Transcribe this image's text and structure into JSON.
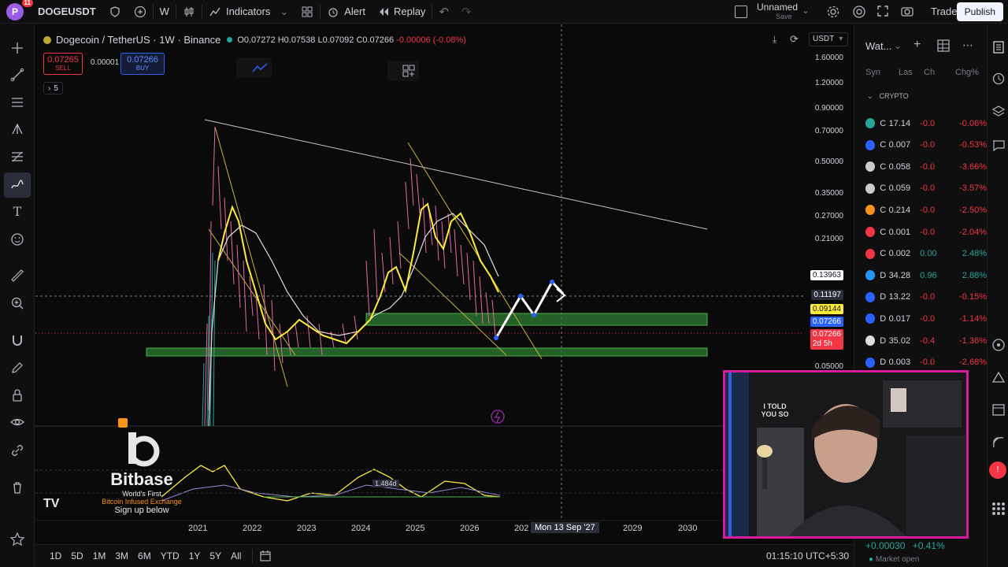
{
  "topbar": {
    "badge_count": "11",
    "symbol": "DOGEUSDT",
    "interval": "W",
    "indicators_label": "Indicators",
    "alert_label": "Alert",
    "replay_label": "Replay",
    "layout_name": "Unnamed",
    "layout_status": "Save",
    "trade_label": "Trade",
    "publish_label": "Publish"
  },
  "legend": {
    "title": "Dogecoin / TetherUS · 1W · Binance",
    "open": "O0.07272",
    "high": "H0.07538",
    "low": "L0.07092",
    "close": "C0.07266",
    "change": "-0.00006 (-0.08%)"
  },
  "trade": {
    "sell_price": "0.07265",
    "sell_label": "SELL",
    "spread": "0.00001",
    "buy_price": "0.07266",
    "buy_label": "BUY"
  },
  "indicator_count": "5",
  "currency": "USDT",
  "price_axis": [
    "1.60000",
    "1.20000",
    "0.90000",
    "0.70000",
    "0.50000",
    "0.35000",
    "0.27000",
    "0.21000",
    "0.05000"
  ],
  "price_tags": {
    "hover": "0.13963",
    "crosshair": "0.11197",
    "yellow": "0.09144",
    "blue": "0.07266",
    "last": "0.07266",
    "countdown": "2d 5h"
  },
  "time_axis": [
    "2021",
    "2022",
    "2023",
    "2024",
    "2025",
    "2026",
    "202",
    "2029",
    "2030"
  ],
  "time_crosshair": "Mon 13 Sep '27",
  "volume_label": "1.484d",
  "bitbase": {
    "name": "Bitbase",
    "tagline1": "World's First",
    "tagline2": "Bitcoin Infused Exchange",
    "cta": "Sign up below"
  },
  "timeframes": [
    "1D",
    "5D",
    "1M",
    "3M",
    "6M",
    "YTD",
    "1Y",
    "5Y",
    "All"
  ],
  "clock": "01:15:10 UTC+5:30",
  "watchlist": {
    "title": "Wat...",
    "cols": [
      "Syn",
      "Las",
      "Ch",
      "Chg%"
    ],
    "section": "CRYPTO",
    "rows": [
      {
        "sym": "C",
        "last": "17.14",
        "chg": "-0.0",
        "chgp": "-0.06%",
        "color": "#26a69a"
      },
      {
        "sym": "C",
        "last": "0.007",
        "chg": "-0.0",
        "chgp": "-0.53%",
        "color": "#2962ff"
      },
      {
        "sym": "C",
        "last": "0.058",
        "chg": "-0.0",
        "chgp": "-3.66%",
        "color": "#cccccc"
      },
      {
        "sym": "C",
        "last": "0.059",
        "chg": "-0.0",
        "chgp": "-3.57%",
        "color": "#cccccc"
      },
      {
        "sym": "C",
        "last": "0.214",
        "chg": "-0.0",
        "chgp": "-2.50%",
        "color": "#f7931a"
      },
      {
        "sym": "C",
        "last": "0.001",
        "chg": "-0.0",
        "chgp": "-2.04%",
        "color": "#f23645"
      },
      {
        "sym": "C",
        "last": "0.002",
        "chg": "0.00",
        "chgp": "2.48%",
        "color": "#f23645"
      },
      {
        "sym": "D",
        "last": "34.28",
        "chg": "0.96",
        "chgp": "2.88%",
        "color": "#2196f3"
      },
      {
        "sym": "D",
        "last": "13.22",
        "chg": "-0.0",
        "chgp": "-0.15%",
        "color": "#2962ff"
      },
      {
        "sym": "D",
        "last": "0.017",
        "chg": "-0.0",
        "chgp": "-1.14%",
        "color": "#2962ff"
      },
      {
        "sym": "D",
        "last": "35.02",
        "chg": "-0.4",
        "chgp": "-1.36%",
        "color": "#dddddd"
      },
      {
        "sym": "D",
        "last": "0.003",
        "chg": "-0.0",
        "chgp": "-2.68%",
        "color": "#2962ff"
      }
    ],
    "footer_change": "+0.00030",
    "footer_pct": "+0.41%",
    "market_status": "Market open"
  },
  "webcam": {
    "shirt_text": "I TOLD YOU SO"
  }
}
